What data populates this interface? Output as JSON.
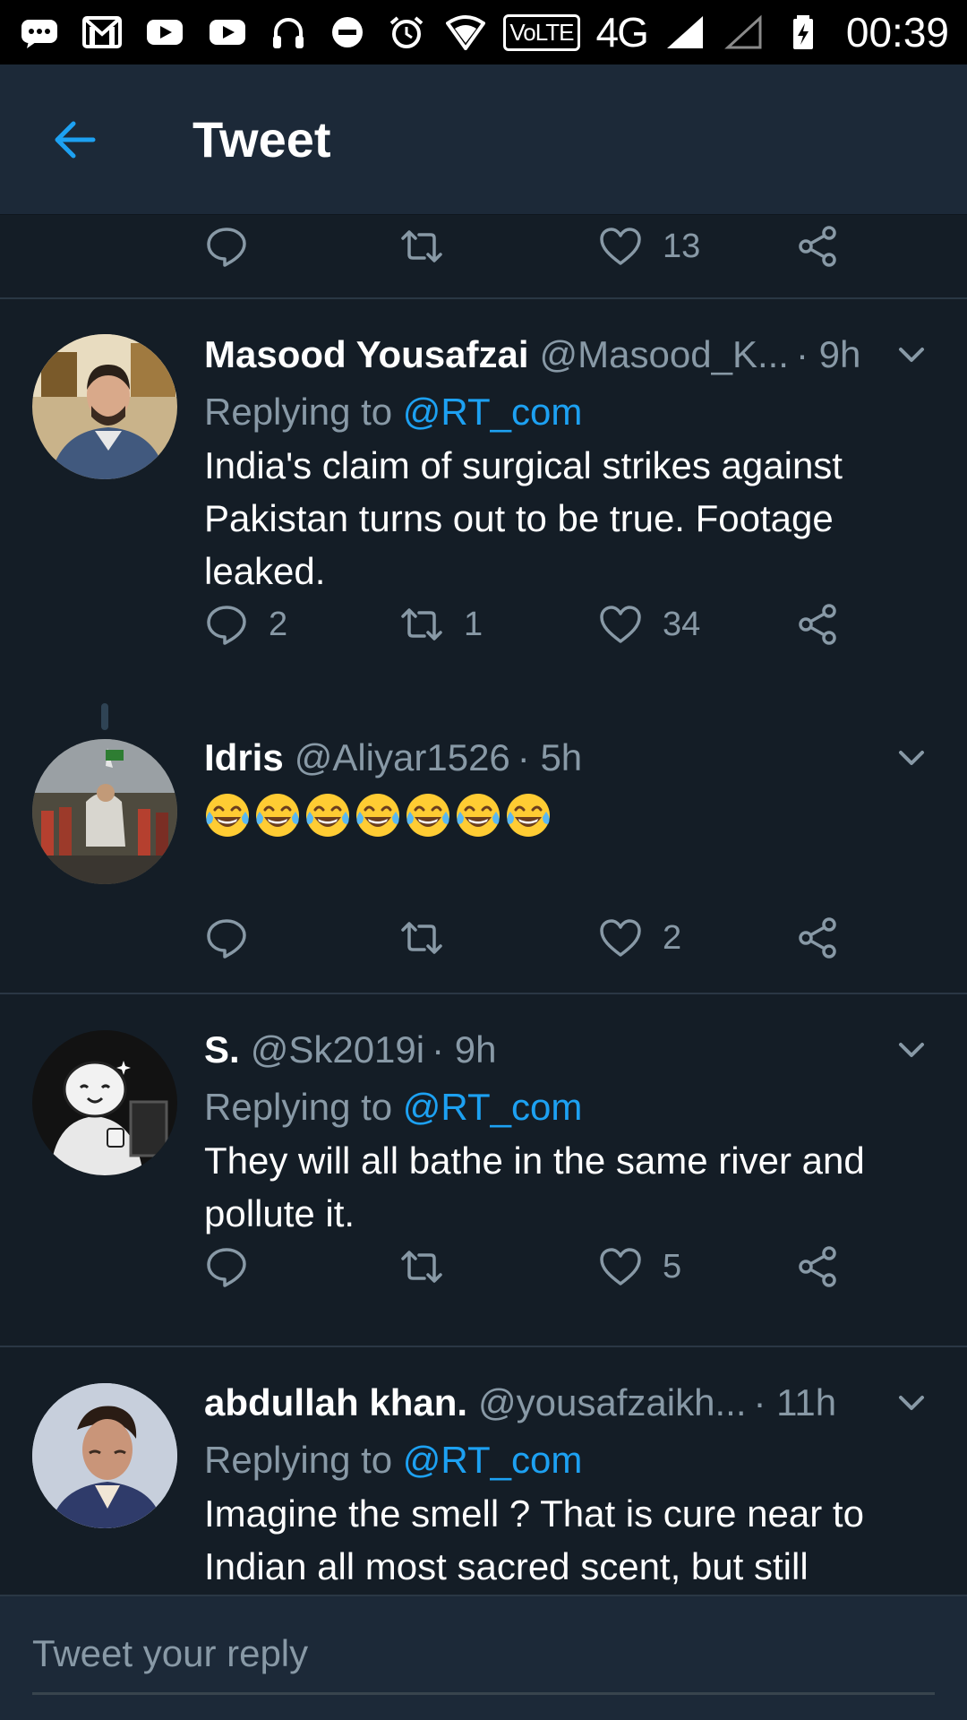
{
  "status_bar": {
    "network_type": "4G",
    "volte_label": "VoLTE",
    "time": "00:39"
  },
  "app_bar": {
    "title": "Tweet"
  },
  "top_actions": {
    "like_count": "13"
  },
  "tweets": [
    {
      "name": "Masood Yousafzai",
      "handle": "@Masood_K...",
      "time": "· 9h",
      "replying_prefix": "Replying to ",
      "replying_to": "@RT_com",
      "text": "India's claim of surgical strikes against Pakistan turns out to be true. Footage leaked.",
      "reply_count": "2",
      "retweet_count": "1",
      "like_count": "34"
    },
    {
      "name": "Idris",
      "handle": "@Aliyar1526",
      "time": "· 5h",
      "emoji": "😂😂😂😂😂😂😂",
      "emoji_count": 7,
      "like_count": "2"
    },
    {
      "name": "S.",
      "handle": "@Sk2019i",
      "time": "· 9h",
      "replying_prefix": "Replying to ",
      "replying_to": "@RT_com",
      "text": "They will all bathe in the same river and pollute it.",
      "like_count": "5"
    },
    {
      "name": "abdullah khan.",
      "handle": "@yousafzaikh...",
      "time": "· 11h",
      "replying_prefix": "Replying to ",
      "replying_to": "@RT_com",
      "text": "Imagine the smell ? That is cure near to Indian all most sacred scent, but still"
    }
  ],
  "composer": {
    "placeholder": "Tweet your reply"
  },
  "colors": {
    "background": "#141d26",
    "app_bar": "#1c2938",
    "accent": "#1da1f2",
    "secondary_text": "#8899a6"
  },
  "icons": {
    "back": "arrow-left-icon",
    "reply": "speech-bubble-icon",
    "retweet": "retweet-arrows-icon",
    "like": "heart-icon",
    "share": "share-nodes-icon",
    "menu": "chevron-down-icon"
  }
}
